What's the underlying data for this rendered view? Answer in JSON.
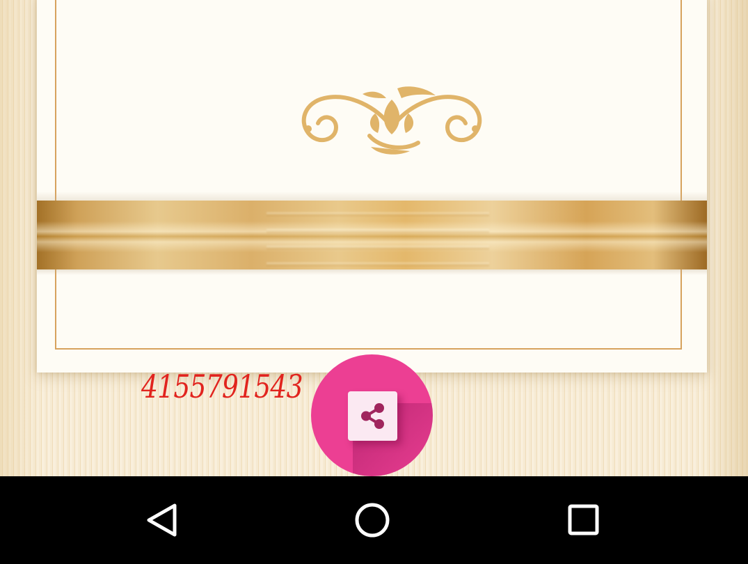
{
  "card": {
    "phone_number": "4155791543"
  },
  "share_button": {
    "icon": "share-icon"
  },
  "navigation_bar": {
    "back_icon": "back-triangle-icon",
    "home_icon": "home-circle-icon",
    "recents_icon": "recents-square-icon"
  },
  "colors": {
    "card_background": "#fefcf5",
    "gold_accent": "#d7a25d",
    "phone_number_text": "#e1241e",
    "share_fab": "#ec3f93",
    "navbar": "#000000"
  }
}
